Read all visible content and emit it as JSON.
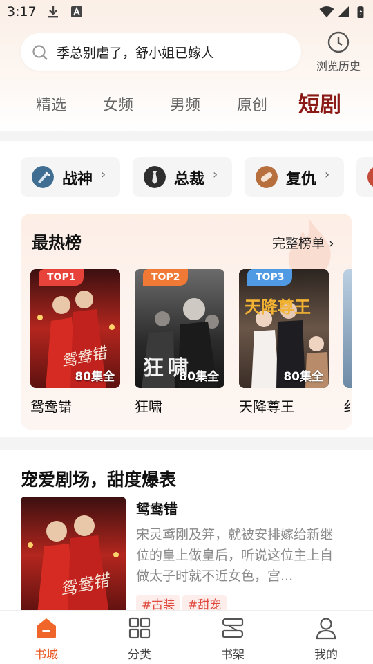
{
  "status_bar": {
    "time": "3:17"
  },
  "search": {
    "placeholder": "季总别虐了，舒小姐已嫁人"
  },
  "history": {
    "label": "浏览历史"
  },
  "tabs": [
    {
      "label": "精选"
    },
    {
      "label": "女频"
    },
    {
      "label": "男频"
    },
    {
      "label": "原创"
    },
    {
      "label": "短剧",
      "active": true
    }
  ],
  "categories": [
    {
      "label": "战神",
      "icon": "war-god-icon"
    },
    {
      "label": "总裁",
      "icon": "ceo-icon"
    },
    {
      "label": "复仇",
      "icon": "revenge-icon"
    }
  ],
  "ranking": {
    "title": "最热榜",
    "more_label": "完整榜单",
    "items": [
      {
        "badge": "TOP1",
        "title": "鸳鸯错",
        "episodes": "80集全",
        "cover_text": "鸳鸯错",
        "badge_color": "#e8433a"
      },
      {
        "badge": "TOP2",
        "title": "狂啸",
        "episodes": "80集全",
        "cover_text": "狂啸",
        "badge_color": "#f07a35"
      },
      {
        "badge": "TOP3",
        "title": "天降尊王",
        "episodes": "80集全",
        "cover_text": "天降尊王",
        "badge_color": "#4f9ae3"
      },
      {
        "title": "纟"
      }
    ]
  },
  "recommend": {
    "heading": "宠爱剧场，甜度爆表",
    "item": {
      "title": "鸳鸯错",
      "description": "宋灵鸢刚及笄，就被安排嫁给新继位的皇上做皇后，听说这位主上自做太子时就不近女色，宫...",
      "cover_text": "鸳鸯错",
      "tags": [
        "#古装",
        "#甜宠"
      ]
    }
  },
  "bottom_nav": [
    {
      "label": "书城",
      "icon": "bookstore-icon",
      "active": true
    },
    {
      "label": "分类",
      "icon": "category-icon"
    },
    {
      "label": "书架",
      "icon": "bookshelf-icon"
    },
    {
      "label": "我的",
      "icon": "profile-icon"
    }
  ],
  "colors": {
    "accent": "#e9541c",
    "tab_active": "#8b1a16",
    "tag": "#e04a3f"
  }
}
